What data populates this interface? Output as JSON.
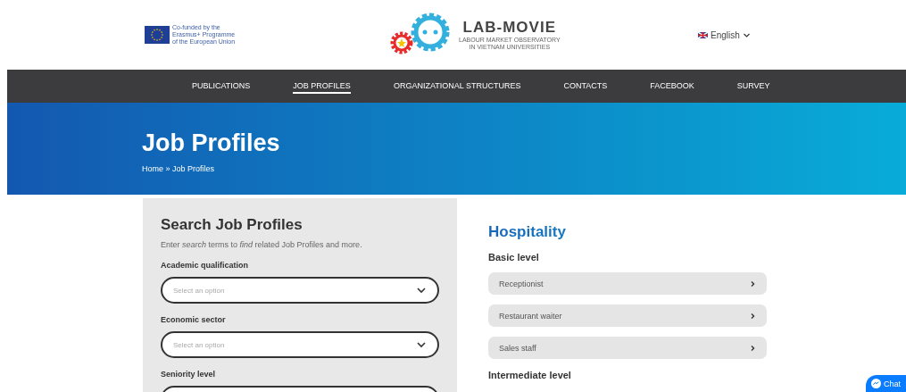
{
  "header": {
    "eu_logo_text": [
      "Co-funded by the",
      "Erasmus+ Programme",
      "of the European Union"
    ],
    "logo": {
      "name": "LAB-MOVIE",
      "tagline": [
        "LABOUR MARKET OBSERVATORY",
        "IN VIETNAM UNIVERSITIES"
      ]
    },
    "language": "English"
  },
  "nav": [
    {
      "label": "PUBLICATIONS",
      "selected": false
    },
    {
      "label": "JOB PROFILES",
      "selected": true
    },
    {
      "label": "ORGANIZATIONAL STRUCTURES",
      "selected": false
    },
    {
      "label": "CONTACTS",
      "selected": false
    },
    {
      "label": "FACEBOOK",
      "selected": false
    },
    {
      "label": "SURVEY",
      "selected": false
    }
  ],
  "hero": {
    "title": "Job Profiles",
    "breadcrumb": "Home » Job Profiles"
  },
  "search": {
    "title": "Search Job Profiles",
    "description": "Enter *search* terms to *find* related Job Profiles and more.",
    "filters": [
      {
        "label": "Academic qualification",
        "placeholder": "Select an option"
      },
      {
        "label": "Economic sector",
        "placeholder": "Select an option"
      },
      {
        "label": "Seniority level"
      }
    ]
  },
  "results": {
    "title": "Hospitality",
    "groups": [
      {
        "title": "Basic level",
        "items": [
          "Receptionist",
          "Restaurant waiter",
          "Sales staff"
        ]
      },
      {
        "title": "Intermediate level"
      }
    ]
  },
  "chat_button": "Chat"
}
